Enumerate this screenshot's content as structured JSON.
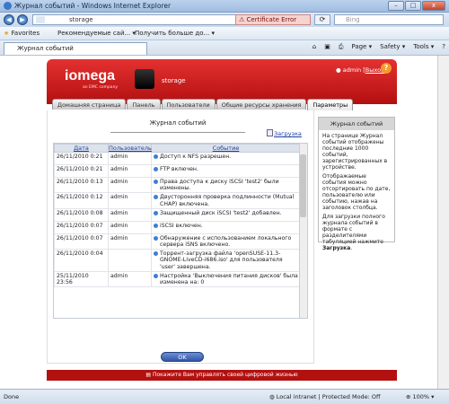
{
  "window": {
    "title": "Журнал событий - Windows Internet Explorer",
    "controls": [
      "–",
      "□",
      "x"
    ]
  },
  "address": {
    "host": "storage",
    "cert_error": "Certificate Error",
    "search_placeholder": "Bing"
  },
  "favorites": {
    "label": "Favorites",
    "items": [
      "Рекомендуемые сай...",
      "Получить больше до..."
    ]
  },
  "browser_tab": {
    "label": "Журнал событий"
  },
  "toolbar": {
    "page": "Page",
    "safety": "Safety",
    "tools": "Tools"
  },
  "app": {
    "logo": "iomega",
    "logo_sub": "an EMC company",
    "device_name": "storage",
    "user": "admin",
    "logout": "Выход",
    "help": "?",
    "tabs": [
      {
        "label": "Домашняя страница",
        "active": false
      },
      {
        "label": "Панель",
        "active": false
      },
      {
        "label": "Пользователи",
        "active": false
      },
      {
        "label": "Общие ресурсы хранения",
        "active": false
      },
      {
        "label": "Параметры",
        "active": true
      }
    ]
  },
  "main": {
    "title": "Журнал событий",
    "download": "Загрузка",
    "columns": [
      "Дата",
      "Пользователь",
      "Событие"
    ],
    "rows": [
      {
        "date": "26/11/2010 0:21",
        "user": "admin",
        "event": "Доступ к NFS разрешен."
      },
      {
        "date": "26/11/2010 0:21",
        "user": "admin",
        "event": "FTP включен."
      },
      {
        "date": "26/11/2010 0:13",
        "user": "admin",
        "event": "Права доступа к диску iSCSI 'test2' были изменены."
      },
      {
        "date": "26/11/2010 0:12",
        "user": "admin",
        "event": "Двусторонняя проверка подлинности (Mutual CHAP) включена."
      },
      {
        "date": "26/11/2010 0:08",
        "user": "admin",
        "event": "Защищенный диск iSCSI 'test2' добавлен."
      },
      {
        "date": "26/11/2010 0:07",
        "user": "admin",
        "event": "iSCSI включен."
      },
      {
        "date": "26/11/2010 0:07",
        "user": "admin",
        "event": "Обнаружение с использованием локального сервера iSNS включено."
      },
      {
        "date": "26/11/2010 0:04",
        "user": "",
        "event": "Торрент-загрузка файла 'openSUSE-11.3-GNOME-LiveCD-i686.iso' для пользователя 'user' завершена."
      },
      {
        "date": "25/11/2010 23:56",
        "user": "admin",
        "event": "Настройка 'Выключения питания дисков' была изменена на: 0"
      }
    ],
    "ok_label": "OK"
  },
  "sidebar": {
    "title": "Журнал событий",
    "p1": "На странице Журнал событий отображены последние 1000 событий, зарегистрированных в устройстве.",
    "p2": "Отображаемые события можно отсортировать по дате, пользователю или событию, нажав на заголовок столбца.",
    "p3_pre": "Для загрузки полного журнала событий в формате с разделителями табуляцией нажмите ",
    "p3_bold": "Загрузка",
    "p3_post": "."
  },
  "footer": {
    "text": "Покажите Вам управлять своей цифровой жизнью"
  },
  "status": {
    "left": "Done",
    "zone": "Local intranet | Protected Mode: Off",
    "zoom": "100%"
  },
  "colors": {
    "brand_red": "#c41a1a",
    "link": "#1a3ea0"
  }
}
